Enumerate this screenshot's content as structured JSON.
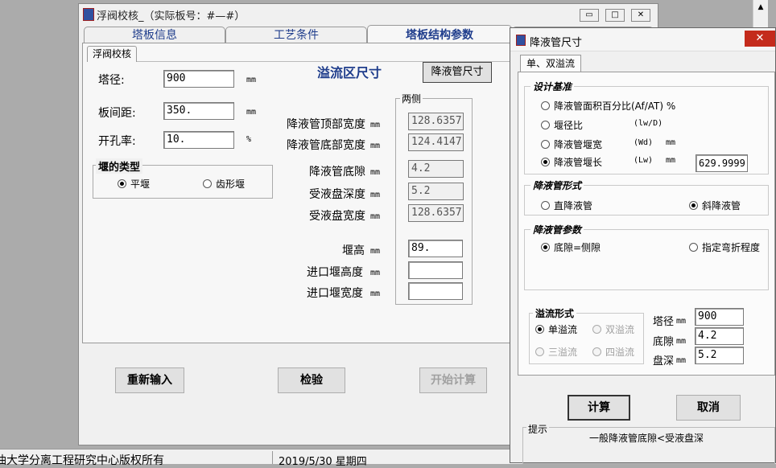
{
  "main": {
    "title": "浮阀校核_（实际板号：#—#）",
    "tabs": [
      "塔板信息",
      "工艺条件",
      "塔板结构参数"
    ],
    "subtab": "浮阀校核",
    "fields": {
      "diameter": {
        "label": "塔径:",
        "value": "900",
        "unit": "mm"
      },
      "spacing": {
        "label": "板间距:",
        "value": "350.",
        "unit": "mm"
      },
      "open_ratio": {
        "label": "开孔率:",
        "value": "10.",
        "unit": "%"
      }
    },
    "weir_group": {
      "title": "堰的类型",
      "options": [
        "平堰",
        "齿形堰"
      ]
    },
    "overflow_title": "溢流区尺寸",
    "downcomer_btn": "降液管尺寸",
    "both_sides": "两侧",
    "rows": [
      {
        "label": "降液管顶部宽度",
        "unit": "mm",
        "value": "128.6357"
      },
      {
        "label": "降液管底部宽度",
        "unit": "mm",
        "value": "124.4147"
      },
      {
        "label": "降液管底隙",
        "unit": "mm",
        "value": "4.2"
      },
      {
        "label": "受液盘深度",
        "unit": "mm",
        "value": "5.2"
      },
      {
        "label": "受液盘宽度",
        "unit": "mm",
        "value": "128.6357"
      }
    ],
    "weir_rows": [
      {
        "label": "堰高",
        "unit": "mm",
        "value": "89."
      },
      {
        "label": "进口堰高度",
        "unit": "mm",
        "value": ""
      },
      {
        "label": "进口堰宽度",
        "unit": "mm",
        "value": ""
      }
    ],
    "buttons": {
      "reset": "重新输入",
      "check": "检验",
      "calc": "开始计算"
    }
  },
  "status": {
    "copyright": "油大学分离工程研究中心版权所有",
    "date": "2019/5/30 星期四"
  },
  "dialog": {
    "title": "降液管尺寸",
    "tab": "单、双溢流",
    "basis": {
      "title": "设计基准",
      "options": [
        {
          "label": "降液管面积百分比(Af/AT) %",
          "sym": "",
          "unit": ""
        },
        {
          "label": "堰径比",
          "sym": "(lw/D)",
          "unit": ""
        },
        {
          "label": "降液管堰宽",
          "sym": "(Wd)",
          "unit": "mm"
        },
        {
          "label": "降液管堰长",
          "sym": "(Lw)",
          "unit": "mm"
        }
      ],
      "value": "629.9999"
    },
    "form": {
      "title": "降液管形式",
      "options": [
        "直降液管",
        "斜降液管"
      ]
    },
    "params": {
      "title": "降液管参数",
      "options": [
        "底隙=侧隙",
        "指定弯折程度"
      ]
    },
    "overflow": {
      "title": "溢流形式",
      "options": [
        "单溢流",
        "双溢流",
        "三溢流",
        "四溢流"
      ]
    },
    "right_fields": [
      {
        "label": "塔径",
        "unit": "mm",
        "value": "900"
      },
      {
        "label": "底隙",
        "unit": "mm",
        "value": "4.2"
      },
      {
        "label": "盘深",
        "unit": "mm",
        "value": "5.2"
      }
    ],
    "buttons": {
      "calc": "计算",
      "cancel": "取消"
    },
    "hint_title": "提示",
    "hint": "一般降液管底隙<受液盘深"
  }
}
